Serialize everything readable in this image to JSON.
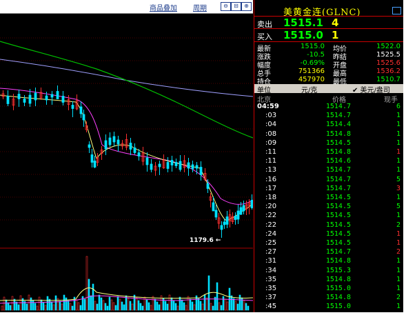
{
  "toolbar": {
    "overlay_label": "商品叠加",
    "period_label": "周期",
    "btn1": "⊖",
    "btn2": "⊟",
    "btn3": "⊕"
  },
  "chart": {
    "low_label": "1179.6 ←"
  },
  "header": {
    "title": "美黄金连(GLNC)"
  },
  "quote": {
    "sell_label": "卖出",
    "sell_price": "1515.1",
    "sell_volume": "4",
    "buy_label": "买入",
    "buy_price": "1515.0",
    "buy_volume": "1",
    "stats": [
      {
        "label": "最新",
        "value": "1515.0",
        "color": "green",
        "label2": "均价",
        "value2": "1522.0",
        "color2": "green"
      },
      {
        "label": "涨跌",
        "value": "-10.5",
        "color": "green",
        "label2": "昨结",
        "value2": "1525.5",
        "color2": "white"
      },
      {
        "label": "幅度",
        "value": "-0.69%",
        "color": "green",
        "label2": "开盘",
        "value2": "1525.6",
        "color2": "red"
      },
      {
        "label": "总手",
        "value": "751366",
        "color": "yellow",
        "label2": "最高",
        "value2": "1536.2",
        "color2": "red"
      },
      {
        "label": "持仓",
        "value": "457970",
        "color": "yellow",
        "label2": "最低",
        "value2": "1510.7",
        "color2": "green"
      }
    ]
  },
  "units": {
    "label": "单位",
    "option1": "元/克",
    "option2": "✔ 美元/盎司"
  },
  "ticks_header": {
    "time": "北京",
    "price": "价格",
    "volume": "现手"
  },
  "ticks": [
    {
      "time": "04:59",
      "price": "1514.7",
      "vol": "6",
      "vc": "green"
    },
    {
      "time": ":03",
      "price": "1514.7",
      "vol": "1",
      "vc": "green"
    },
    {
      "time": ":04",
      "price": "1514.4",
      "vol": "1",
      "vc": "green"
    },
    {
      "time": ":08",
      "price": "1514.8",
      "vol": "1",
      "vc": "green"
    },
    {
      "time": ":09",
      "price": "1514.5",
      "vol": "1",
      "vc": "green"
    },
    {
      "time": ":11",
      "price": "1514.8",
      "vol": "1",
      "vc": "red"
    },
    {
      "time": ":11",
      "price": "1514.6",
      "vol": "1",
      "vc": "green"
    },
    {
      "time": ":13",
      "price": "1514.7",
      "vol": "1",
      "vc": "green"
    },
    {
      "time": ":16",
      "price": "1514.7",
      "vol": "5",
      "vc": "green"
    },
    {
      "time": ":17",
      "price": "1514.7",
      "vol": "3",
      "vc": "red"
    },
    {
      "time": ":18",
      "price": "1514.5",
      "vol": "1",
      "vc": "green"
    },
    {
      "time": ":20",
      "price": "1514.5",
      "vol": "5",
      "vc": "green"
    },
    {
      "time": ":22",
      "price": "1514.5",
      "vol": "1",
      "vc": "green"
    },
    {
      "time": ":22",
      "price": "1514.5",
      "vol": "2",
      "vc": "green"
    },
    {
      "time": ":24",
      "price": "1514.5",
      "vol": "1",
      "vc": "red"
    },
    {
      "time": ":25",
      "price": "1514.5",
      "vol": "1",
      "vc": "red"
    },
    {
      "time": ":27",
      "price": "1514.7",
      "vol": "2",
      "vc": "red"
    },
    {
      "time": ":31",
      "price": "1514.8",
      "vol": "1",
      "vc": "green"
    },
    {
      "time": ":34",
      "price": "1515.3",
      "vol": "1",
      "vc": "green"
    },
    {
      "time": ":35",
      "price": "1514.8",
      "vol": "1",
      "vc": "green"
    },
    {
      "time": ":35",
      "price": "1515.0",
      "vol": "1",
      "vc": "green"
    },
    {
      "time": ":37",
      "price": "1514.8",
      "vol": "2",
      "vc": "green"
    },
    {
      "time": ":45",
      "price": "1515.0",
      "vol": "1",
      "vc": "green"
    }
  ],
  "colors": {
    "up": "#ff3030",
    "down": "#00ff00",
    "candle_down": "#00e0ff",
    "ma_fast": "#ffff80",
    "ma_mid": "#ff40ff",
    "ma_slow": "#a0a0ff",
    "ma_long": "#00c000"
  }
}
